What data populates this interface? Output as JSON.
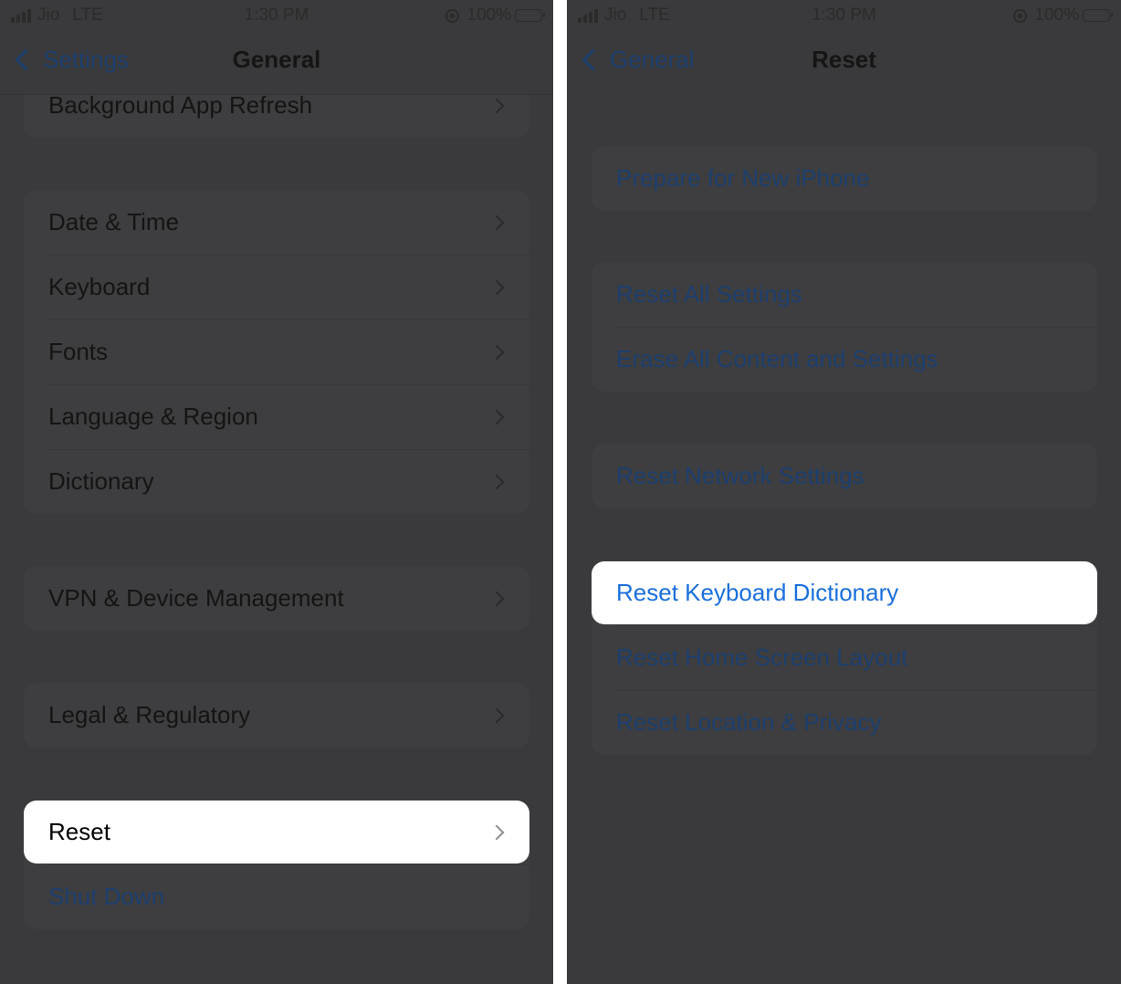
{
  "colors": {
    "dim_background": "#3a3a3c",
    "dim_text": "#141414",
    "dim_link": "#1c3f6e",
    "highlight_background": "#ffffff",
    "highlight_link": "#1a6fdc"
  },
  "left_screen": {
    "status": {
      "carrier": "Jio",
      "network": "LTE",
      "time": "1:30 PM",
      "battery": "100%"
    },
    "nav": {
      "back_label": "Settings",
      "title": "General"
    },
    "groups": [
      {
        "items": [
          {
            "label": "Background App Refresh"
          }
        ]
      },
      {
        "items": [
          {
            "label": "Date & Time"
          },
          {
            "label": "Keyboard"
          },
          {
            "label": "Fonts"
          },
          {
            "label": "Language & Region"
          },
          {
            "label": "Dictionary"
          }
        ]
      },
      {
        "items": [
          {
            "label": "VPN & Device Management"
          }
        ]
      },
      {
        "items": [
          {
            "label": "Legal & Regulatory"
          }
        ]
      },
      {
        "items": [
          {
            "label": "Reset",
            "highlighted": true
          },
          {
            "label": "Shut Down"
          }
        ]
      }
    ]
  },
  "right_screen": {
    "status": {
      "carrier": "Jio",
      "network": "LTE",
      "time": "1:30 PM",
      "battery": "100%"
    },
    "nav": {
      "back_label": "General",
      "title": "Reset"
    },
    "groups": [
      {
        "items": [
          {
            "label": "Prepare for New iPhone"
          }
        ]
      },
      {
        "items": [
          {
            "label": "Reset All Settings"
          },
          {
            "label": "Erase All Content and Settings"
          }
        ]
      },
      {
        "items": [
          {
            "label": "Reset Network Settings"
          }
        ]
      },
      {
        "items": [
          {
            "label": "Reset Keyboard Dictionary",
            "highlighted": true
          },
          {
            "label": "Reset Home Screen Layout"
          },
          {
            "label": "Reset Location & Privacy"
          }
        ]
      }
    ]
  }
}
